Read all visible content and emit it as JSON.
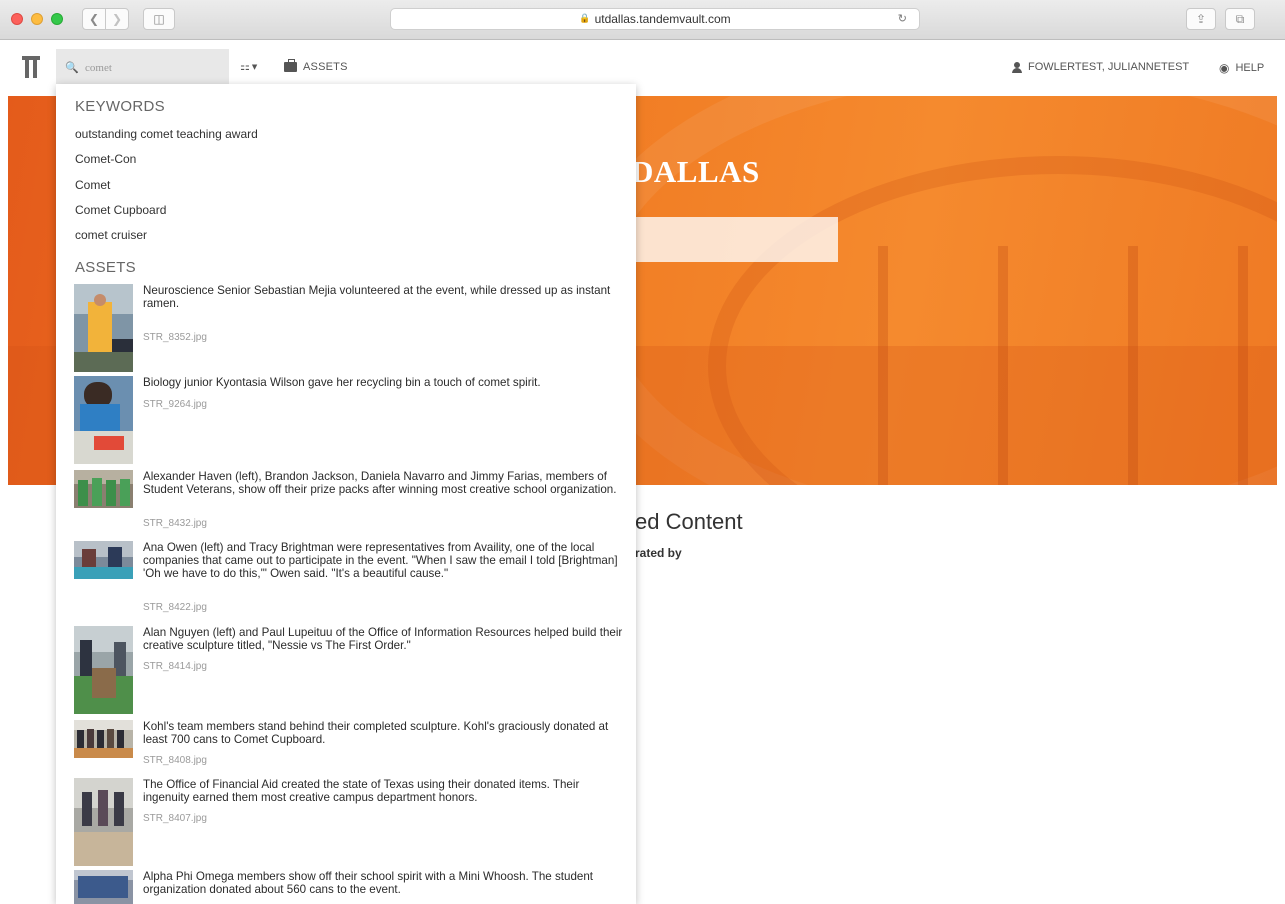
{
  "browser": {
    "url": "utdallas.tandemvault.com"
  },
  "appbar": {
    "search_value": "comet",
    "assets_label": "ASSETS",
    "user_label": "FOWLERTEST, JULIANNETEST",
    "help_label": "HELP"
  },
  "hero": {
    "title_fragment": "DALLAS"
  },
  "featured": {
    "title_fragment": "ed Content",
    "subtitle_fragment": "rated by"
  },
  "dropdown": {
    "keywords_heading": "KEYWORDS",
    "keywords": [
      "outstanding comet teaching award",
      "Comet-Con",
      "Comet",
      "Comet Cupboard",
      "comet cruiser"
    ],
    "assets_heading": "ASSETS",
    "assets": [
      {
        "caption": "Neuroscience Senior Sebastian Mejia volunteered at the event, while dressed up as instant ramen.",
        "filename": "STR_8352.jpg"
      },
      {
        "caption": "Biology junior Kyontasia Wilson gave her recycling bin a touch of comet spirit.",
        "filename": "STR_9264.jpg"
      },
      {
        "caption": "Alexander Haven (left), Brandon Jackson, Daniela Navarro and Jimmy Farias, members of Student Veterans, show off their prize packs after winning most creative school organization.",
        "filename": "STR_8432.jpg"
      },
      {
        "caption": "Ana Owen (left) and Tracy Brightman were representatives from Availity, one of the local companies that came out to participate in the event. \"When I saw the email I told [Brightman] 'Oh we have to do this,'\" Owen said. \"It's a beautiful cause.\"",
        "filename": "STR_8422.jpg"
      },
      {
        "caption": "Alan Nguyen (left) and Paul Lupeituu of the Office of Information Resources helped build their creative sculpture titled, \"Nessie vs The First Order.\"",
        "filename": "STR_8414.jpg"
      },
      {
        "caption": "Kohl's team members stand behind their completed sculpture. Kohl's graciously donated at least 700 cans to Comet Cupboard.",
        "filename": "STR_8408.jpg"
      },
      {
        "caption": "The Office of Financial Aid created the state of Texas using their donated items. Their ingenuity earned them most creative campus department honors.",
        "filename": "STR_8407.jpg"
      },
      {
        "caption": "Alpha Phi Omega members show off their school spirit with a Mini Whoosh. The student organization donated about 560 cans to the event.",
        "filename": ""
      }
    ]
  }
}
